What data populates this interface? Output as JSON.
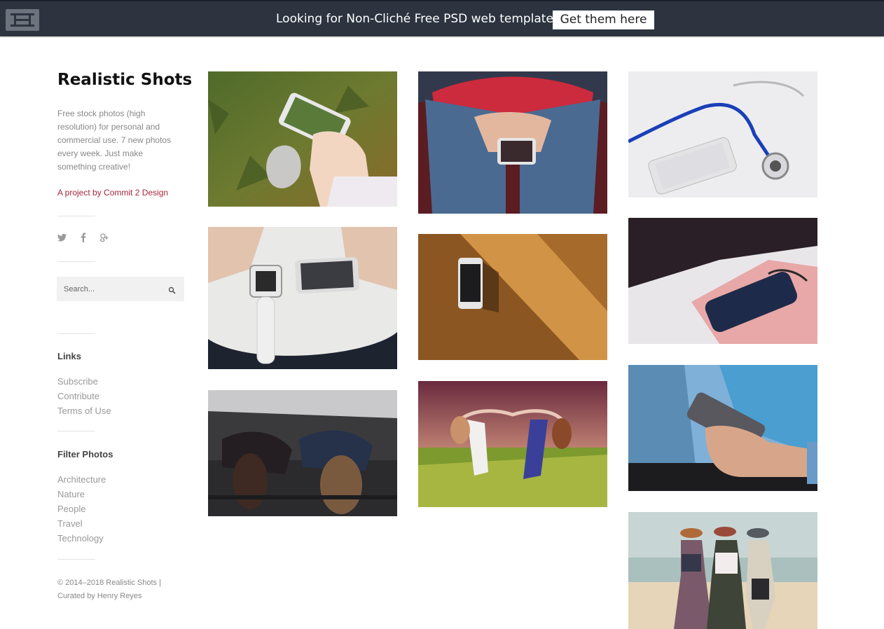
{
  "promo_bar": {
    "text": "Looking for Non-Cliché Free PSD web templates?",
    "button_label": "Get them here",
    "logo_icon": "hh-logo-icon"
  },
  "sidebar": {
    "title": "Realistic Shots",
    "description": "Free stock photos (high resolution) for personal and commercial use. 7 new photos every week. Just make something creative!",
    "project_link": "A project by Commit 2 Design",
    "social_icons": [
      "twitter-icon",
      "facebook-icon",
      "google-plus-icon"
    ],
    "search": {
      "placeholder": "Search..."
    },
    "links": {
      "heading": "Links",
      "items": [
        "Subscribe",
        "Contribute",
        "Terms of Use"
      ]
    },
    "filters": {
      "heading": "Filter Photos",
      "items": [
        "Architecture",
        "Nature",
        "People",
        "Travel",
        "Technology"
      ]
    },
    "footer": {
      "line1": "© 2014–2018 Realistic Shots |",
      "line2": "Curated by Henry Reyes"
    }
  },
  "photos": [
    {
      "subject": "phone-on-grass-with-leaf"
    },
    {
      "subject": "person-holding-phone-in-jeans"
    },
    {
      "subject": "stethoscope-and-phone"
    },
    {
      "subject": "smartwatch-and-phone"
    },
    {
      "subject": "phone-on-wood-desk"
    },
    {
      "subject": "phone-on-notebook"
    },
    {
      "subject": "two-women-lying-on-car"
    },
    {
      "subject": "two-women-in-field"
    },
    {
      "subject": "hand-holding-phone"
    },
    {
      "subject": "three-women-on-beach"
    }
  ],
  "colors": {
    "topbar": "#2d3440",
    "accent_link": "#a6263d"
  }
}
